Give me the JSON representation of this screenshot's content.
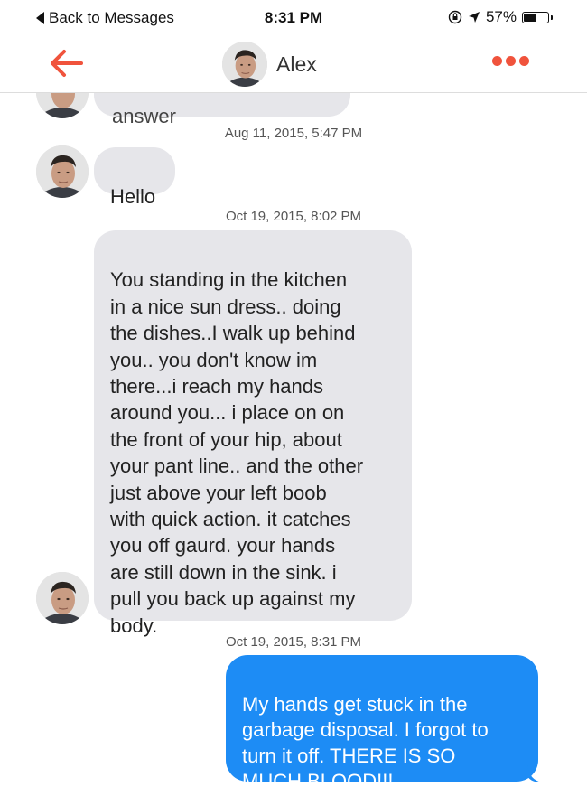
{
  "status_bar": {
    "back_label": "Back to Messages",
    "time": "8:31 PM",
    "battery": "57%",
    "battery_level": 0.57
  },
  "nav": {
    "contact_name": "Alex",
    "accent_color": "#f0533c"
  },
  "conversation": {
    "partial_message_text": "answer",
    "messages": [
      {
        "timestamp": "Aug 11, 2015, 5:47 PM",
        "direction": "incoming",
        "text": "Hello"
      },
      {
        "timestamp": "Oct 19, 2015, 8:02 PM",
        "direction": "incoming",
        "text": "You standing in the kitchen\nin a nice sun dress.. doing\nthe dishes..I walk up behind\nyou.. you don't know im\nthere...i reach my hands\naround you... i place on on\nthe front of your hip, about\nyour pant line.. and the other\njust above your left boob\nwith quick action. it catches\nyou off gaurd. your hands\nare still down in the sink. i\npull you back up against my\nbody."
      },
      {
        "timestamp": "Oct 19, 2015, 8:31 PM",
        "direction": "outgoing",
        "text": "My hands get stuck in the\ngarbage disposal. I forgot to\nturn it off. THERE IS SO\nMUCH BLOOD!!!"
      }
    ],
    "incoming_color": "#e6e6ea",
    "outgoing_color": "#1d8cf5"
  }
}
